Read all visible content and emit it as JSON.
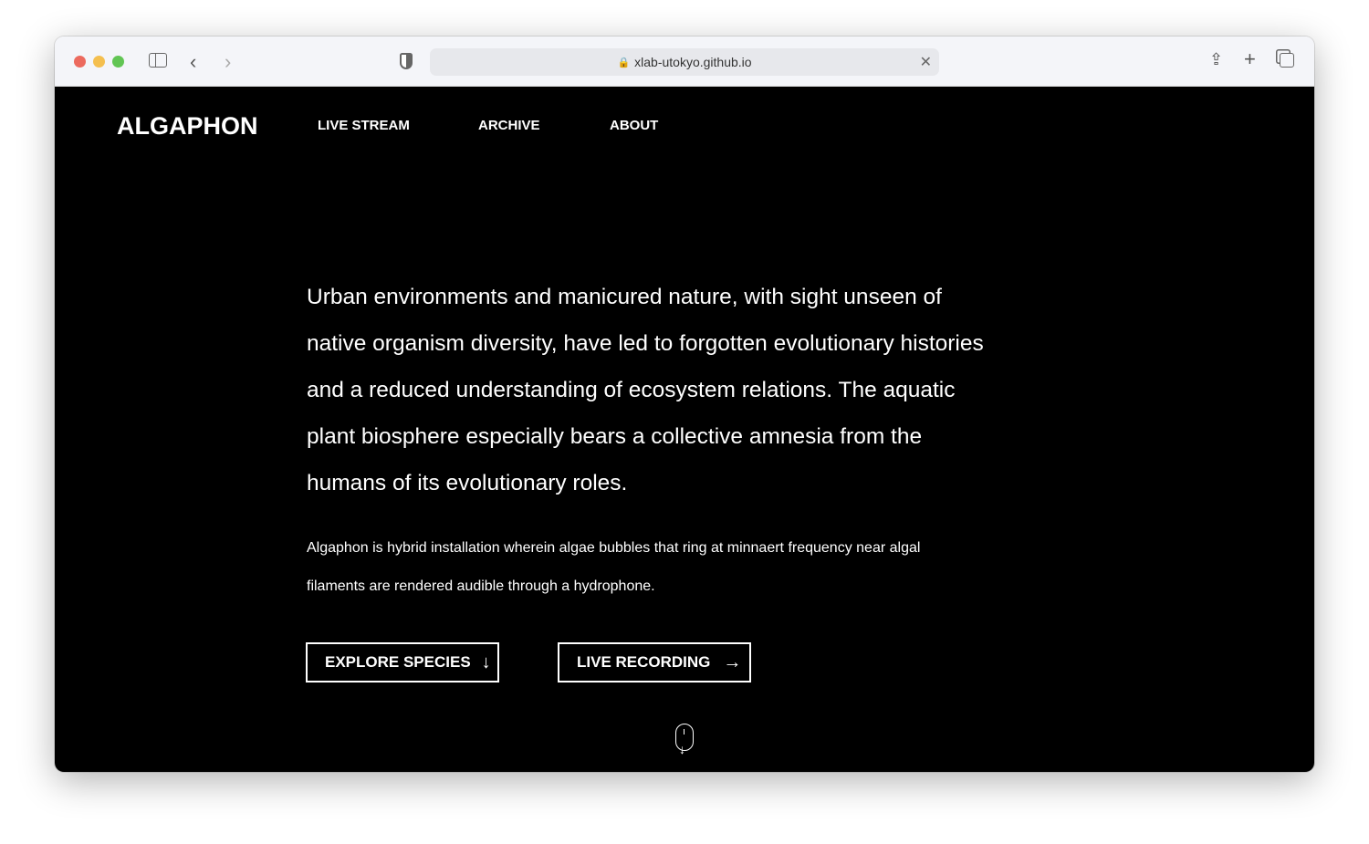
{
  "browser": {
    "url": "xlab-utokyo.github.io",
    "colors": {
      "close": "#ec6a5e",
      "minimize": "#f4bf4f",
      "maximize": "#61c554"
    }
  },
  "site": {
    "logo": "ALGAPHON",
    "nav": [
      {
        "label": "LIVE STREAM"
      },
      {
        "label": "ARCHIVE"
      },
      {
        "label": "ABOUT"
      }
    ]
  },
  "hero": {
    "lead": "Urban environments and manicured nature, with sight unseen of native organism diversity, have led to forgotten evolutionary histories and a reduced understanding of ecosystem relations. The aquatic plant biosphere especially bears a collective amnesia from the humans of its evolutionary roles.",
    "description": "Algaphon is hybrid installation wherein algae bubbles that ring at minnaert frequency near algal filaments are rendered audible through a hydrophone.",
    "buttons": [
      {
        "label": "EXPLORE SPECIES",
        "icon": "arrow-down-icon"
      },
      {
        "label": "LIVE RECORDING",
        "icon": "arrow-right-icon"
      }
    ],
    "scroll_icon": "mouse-scroll-icon"
  }
}
